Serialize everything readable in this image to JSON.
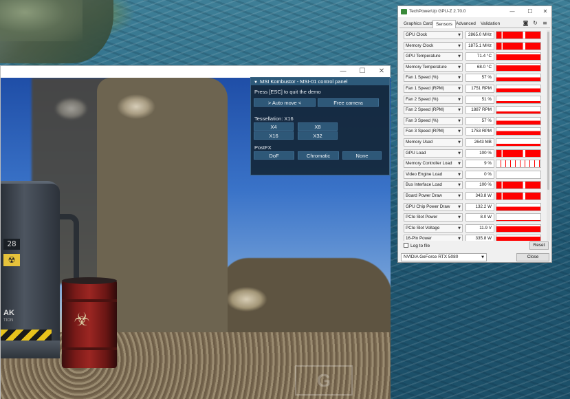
{
  "kombustor": {
    "panel_title": "MSI Kombustor - MSI-01 control panel",
    "hint": "Press [ESC] to quit the demo",
    "auto_move": "> Auto move <",
    "free_camera": "Free camera",
    "tessellation_label": "Tessellation: X16",
    "tess_buttons": [
      "X4",
      "X8",
      "X16",
      "X32"
    ],
    "postfx_label": "PostFX",
    "postfx_buttons": [
      "DoF",
      "Chromatic",
      "None"
    ],
    "scene_counter": "28",
    "scene_radiation_symbol": "☢",
    "scene_machine_label": "AK",
    "scene_machine_sublabel": "TION",
    "scene_barrel_symbol": "☣"
  },
  "gpuz": {
    "title": "TechPowerUp GPU-Z 2.70.0",
    "tabs": [
      "Graphics Card",
      "Sensors",
      "Advanced",
      "Validation"
    ],
    "active_tab": "Sensors",
    "sensors": [
      {
        "label": "GPU Clock",
        "value": "2865.0 MHz"
      },
      {
        "label": "Memory Clock",
        "value": "1875.1 MHz"
      },
      {
        "label": "GPU Temperature",
        "value": "71.4 °C"
      },
      {
        "label": "Memory Temperature",
        "value": "68.0 °C"
      },
      {
        "label": "Fan 1 Speed (%)",
        "value": "57 %"
      },
      {
        "label": "Fan 1 Speed (RPM)",
        "value": "1751 RPM"
      },
      {
        "label": "Fan 2 Speed (%)",
        "value": "51 %"
      },
      {
        "label": "Fan 2 Speed (RPM)",
        "value": "1887 RPM"
      },
      {
        "label": "Fan 3 Speed (%)",
        "value": "57 %"
      },
      {
        "label": "Fan 3 Speed (RPM)",
        "value": "1753 RPM"
      },
      {
        "label": "Memory Used",
        "value": "2643 MB"
      },
      {
        "label": "GPU Load",
        "value": "100 %"
      },
      {
        "label": "Memory Controller Load",
        "value": "9 %"
      },
      {
        "label": "Video Engine Load",
        "value": "0 %"
      },
      {
        "label": "Bus Interface Load",
        "value": "100 %"
      },
      {
        "label": "Board Power Draw",
        "value": "343.8 W"
      },
      {
        "label": "GPU Chip Power Draw",
        "value": "132.2 W"
      },
      {
        "label": "PCIe Slot Power",
        "value": "8.0 W"
      },
      {
        "label": "PCIe Slot Voltage",
        "value": "11.9 V"
      },
      {
        "label": "16-Pin Power",
        "value": "335.8 W"
      }
    ],
    "log_to_file": "Log to file",
    "reset_button": "Reset",
    "gpu_select": "NVIDIA GeForce RTX 5080",
    "close_button": "Close"
  },
  "colors": {
    "graph_red": "#ff0000",
    "panel_bg": "#14283a",
    "panel_button": "#2e5878"
  }
}
